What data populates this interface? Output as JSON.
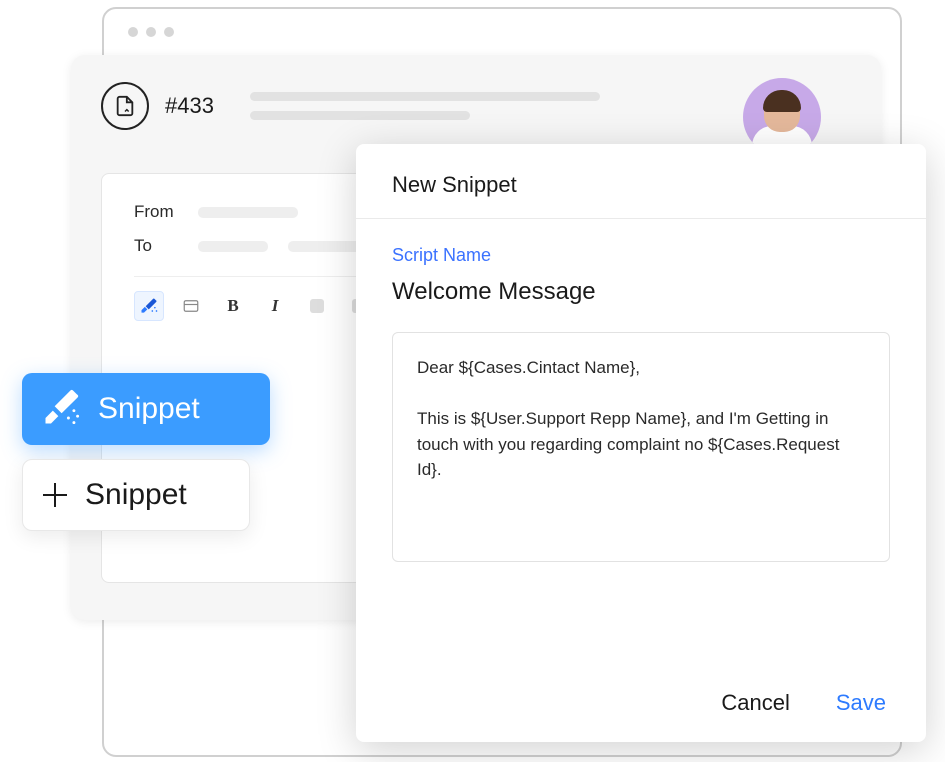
{
  "case": {
    "number": "#433"
  },
  "compose": {
    "from_label": "From",
    "to_label": "To"
  },
  "toolbar": {
    "bold": "B",
    "italic": "I"
  },
  "snippet_buttons": {
    "blue_label": "Snippet",
    "white_label": "Snippet"
  },
  "modal": {
    "title": "New Snippet",
    "script_name_label": "Script Name",
    "script_name_value": "Welcome Message",
    "body": "Dear ${Cases.Cintact Name},\n\nThis is ${User.Support Repp Name}, and I'm Getting in touch with you regarding complaint no ${Cases.Request Id}.",
    "cancel_label": "Cancel",
    "save_label": "Save"
  }
}
